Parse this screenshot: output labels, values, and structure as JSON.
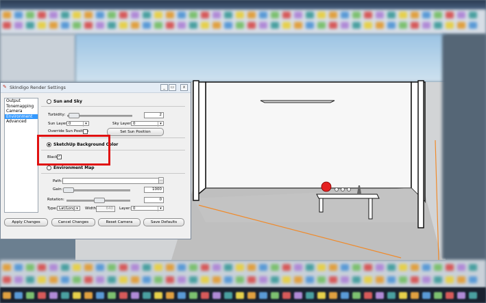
{
  "dialog": {
    "title": "SkIndigo Render Settings",
    "controls": {
      "minimize": "_",
      "restore": "▭",
      "close": "x"
    },
    "nav_items": [
      "Output",
      "Tonemapping",
      "Camera",
      "Environment",
      "Advanced"
    ],
    "selected_nav": "Environment",
    "sun_and_sky": {
      "label": "Sun and Sky",
      "turbidity_label": "Turbidity:",
      "turbidity_value": "2",
      "sun_layer_label": "Sun Layer:",
      "sun_layer_value": "0",
      "sky_layer_label": "Sky Layer:",
      "sky_layer_value": "0",
      "override_label": "Override Sun Position",
      "set_sun_button": "Set Sun Position"
    },
    "background": {
      "label": "SketchUp Background Color",
      "selected": true,
      "black_label": "Black",
      "black_checked": true
    },
    "environment_map": {
      "label": "Environment Map",
      "path_label": "Path:",
      "browse_label": "...",
      "gain_label": "Gain:",
      "gain_value": "1000",
      "rotation_label": "Rotation:",
      "rotation_value": "0",
      "type_label": "Type:",
      "type_value": "Lat/Long",
      "width_label": "Width:",
      "width_value": "640",
      "layer_label": "Layer:",
      "layer_value": "0"
    },
    "buttons": {
      "apply": "Apply Changes",
      "cancel": "Cancel Changes",
      "reset_camera": "Reset Camera",
      "save_defaults": "Save Defaults"
    },
    "check_mark": "✓",
    "dropdown_arrow": "▾"
  },
  "colors": {
    "highlight": "#e01010",
    "selection": "#3399ff",
    "ball": "#e52222"
  }
}
